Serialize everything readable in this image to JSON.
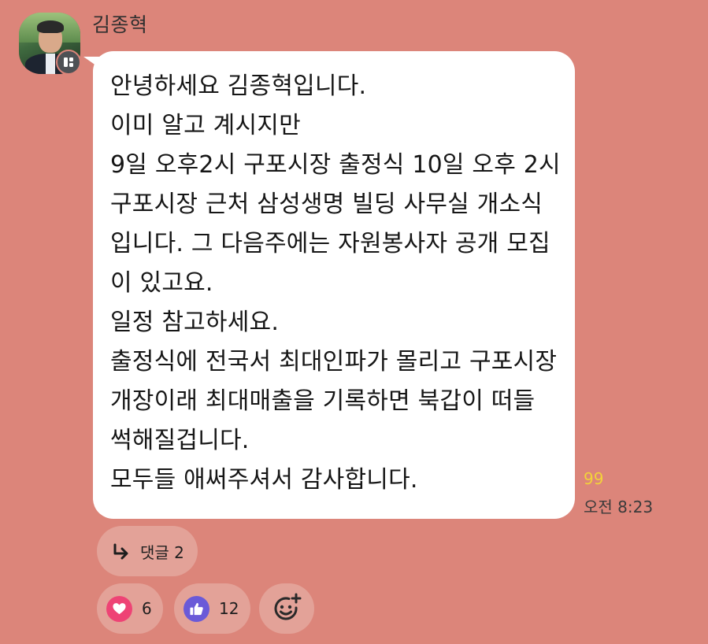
{
  "sender": {
    "name": "김종혁",
    "avatar_icon": "profile-photo-icon",
    "badge_icon": "open-profile-badge-icon"
  },
  "message": {
    "lines": [
      "안녕하세요 김종혁입니다.",
      "이미 알고 계시지만",
      "9일 오후2시 구포시장 출정식 10일 오후 2시",
      "구포시장 근처 삼성생명 빌딩 사무실 개소식",
      "입니다. 그 다음주에는 자원봉사자 공개 모집",
      "이 있고요.",
      "일정 참고하세요.",
      "출정식에 전국서 최대인파가 몰리고 구포시장",
      "개장이래 최대매출을 기록하면 북갑이 떠들",
      "썩해질겁니다.",
      "모두들 애써주셔서 감사합니다."
    ],
    "unread_count": "99",
    "time": "오전 8:23"
  },
  "reply": {
    "label": "댓글 2",
    "icon": "reply-arrow-icon"
  },
  "reactions": [
    {
      "icon": "heart-icon",
      "count": "6",
      "color": "#ee4375"
    },
    {
      "icon": "thumbs-up-icon",
      "count": "12",
      "color": "#6a5ad8"
    }
  ],
  "add_reaction": {
    "icon": "add-emoji-icon"
  },
  "colors": {
    "background": "#dc857a",
    "bubble": "#ffffff",
    "pill": "#e3a298",
    "unread": "#f2d23a"
  }
}
